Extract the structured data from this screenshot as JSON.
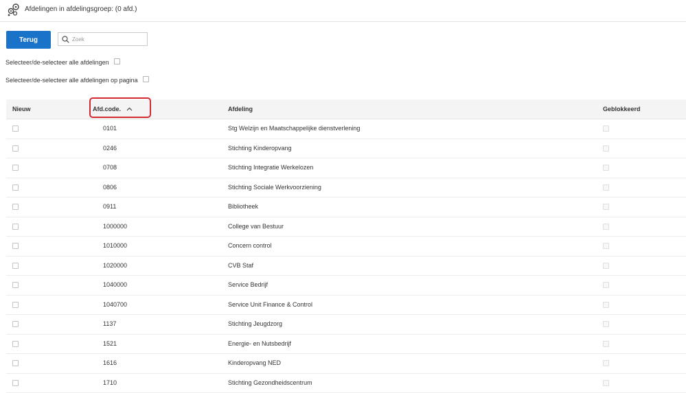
{
  "header": {
    "title": "Afdelingen in afdelingsgroep: (0 afd.)",
    "logo_icon": "cogs-icon"
  },
  "toolbar": {
    "back_label": "Terug",
    "search_placeholder": "Zoek"
  },
  "select_all": {
    "all_label": "Selecteer/de-selecteer alle afdelingen",
    "page_label": "Selecteer/de-selecteer alle afdelingen op pagina"
  },
  "table": {
    "columns": {
      "nieuw": "Nieuw",
      "code": "Afd.code.",
      "afdeling": "Afdeling",
      "geblokkeerd": "Geblokkeerd"
    },
    "sort": {
      "column": "code",
      "direction": "ascending"
    },
    "rows": [
      {
        "code": "0101",
        "name": "Stg Welzijn en Maatschappelijke dienstverlening"
      },
      {
        "code": "0246",
        "name": "Stichting Kinderopvang"
      },
      {
        "code": "0708",
        "name": "Stichting Integratie Werkelozen"
      },
      {
        "code": "0806",
        "name": "Stichting Sociale Werkvoorziening"
      },
      {
        "code": "0911",
        "name": "Bibliotheek"
      },
      {
        "code": "1000000",
        "name": "College van Bestuur"
      },
      {
        "code": "1010000",
        "name": "Concern control"
      },
      {
        "code": "1020000",
        "name": "CVB Staf"
      },
      {
        "code": "1040000",
        "name": "Service Bedrijf"
      },
      {
        "code": "1040700",
        "name": "Service Unit Finance & Control"
      },
      {
        "code": "1137",
        "name": "Stichting Jeugdzorg"
      },
      {
        "code": "1521",
        "name": "Energie- en Nutsbedrijf"
      },
      {
        "code": "1616",
        "name": "Kinderopvang NED"
      },
      {
        "code": "1710",
        "name": "Stichting Gezondheidscentrum"
      }
    ]
  },
  "colors": {
    "accent": "#1a73c8",
    "highlight": "#d2282e"
  }
}
